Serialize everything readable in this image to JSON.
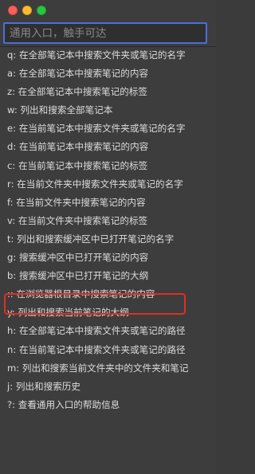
{
  "search": {
    "placeholder": "通用入口，触手可达",
    "value": ""
  },
  "items": [
    "q: 在全部笔记本中搜索文件夹或笔记的名字",
    "a: 在全部笔记本中搜索笔记的内容",
    "z: 在全部笔记本中搜索笔记的标签",
    "w: 列出和搜索全部笔记本",
    "e: 在当前笔记本中搜索文件夹或笔记的名字",
    "d: 在当前笔记本中搜索笔记的内容",
    "c: 在当前笔记本中搜索笔记的标签",
    "r: 在当前文件夹中搜索文件夹或笔记的名字",
    "f: 在当前文件夹中搜索笔记的内容",
    "v: 在当前文件夹中搜索笔记的标签",
    "t: 列出和搜索缓冲区中已打开笔记的名字",
    "g: 搜索缓冲区中已打开笔记的内容",
    "b: 搜索缓冲区中已打开笔记的大纲",
    ":: 在浏览器根目录中搜索笔记的内容",
    "y: 列出和搜索当前笔记的大纲",
    "h: 在全部笔记本中搜索文件夹或笔记的路径",
    "n: 在当前笔记本中搜索文件夹或笔记的路径",
    "m: 列出和搜索当前文件夹中的文件夹和笔记",
    "j: 列出和搜索历史",
    "?: 查看通用入口的帮助信息"
  ],
  "colors": {
    "accent_border": "#4d6fd6",
    "highlight_border": "#e02d24"
  }
}
